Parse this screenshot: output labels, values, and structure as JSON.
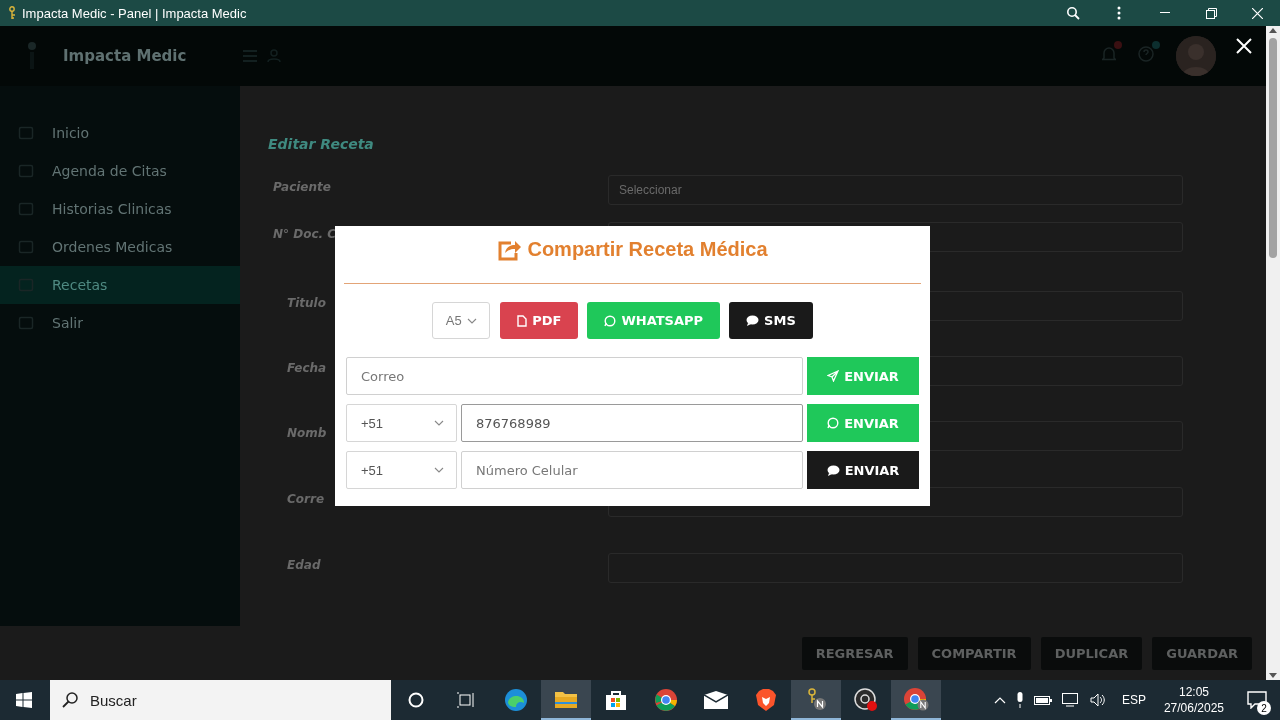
{
  "window": {
    "title": "Impacta Medic - Panel | Impacta Medic"
  },
  "app": {
    "brand": "Impacta Medic",
    "sidebar": [
      {
        "label": "Inicio",
        "selected": false
      },
      {
        "label": "Agenda de Citas",
        "selected": false
      },
      {
        "label": "Historias Clinicas",
        "selected": false
      },
      {
        "label": "Ordenes Medicas",
        "selected": false
      },
      {
        "label": "Recetas",
        "selected": true
      },
      {
        "label": "Salir",
        "selected": false
      }
    ],
    "page_title": "Editar Receta",
    "form": [
      {
        "label": "Paciente",
        "placeholder": "Seleccionar"
      },
      {
        "label": "N° Doc. C"
      },
      {
        "label": "Titulo"
      },
      {
        "label": "Fecha"
      },
      {
        "label": "Nomb"
      },
      {
        "label": "Corre"
      },
      {
        "label": "Edad"
      }
    ],
    "footer_buttons": [
      "REGRESAR",
      "COMPARTIR",
      "DUPLICAR",
      "GUARDAR"
    ]
  },
  "modal": {
    "title": "Compartir Receta Médica",
    "size": "A5",
    "buttons": [
      {
        "kind": "pdf",
        "label": "PDF"
      },
      {
        "kind": "whatsapp",
        "label": "WHATSAPP"
      },
      {
        "kind": "sms",
        "label": "SMS"
      }
    ],
    "rows": [
      {
        "kind": "email",
        "placeholder": "Correo",
        "button": "ENVIAR"
      },
      {
        "kind": "whatsapp",
        "country": "+51",
        "value": "876768989",
        "button": "ENVIAR"
      },
      {
        "kind": "sms",
        "country": "+51",
        "placeholder": "Número Celular",
        "button": "ENVIAR"
      }
    ]
  },
  "taskbar": {
    "search_placeholder": "Buscar",
    "language": "ESP",
    "time": "12:05",
    "date": "27/06/2025",
    "notifications": "2"
  }
}
